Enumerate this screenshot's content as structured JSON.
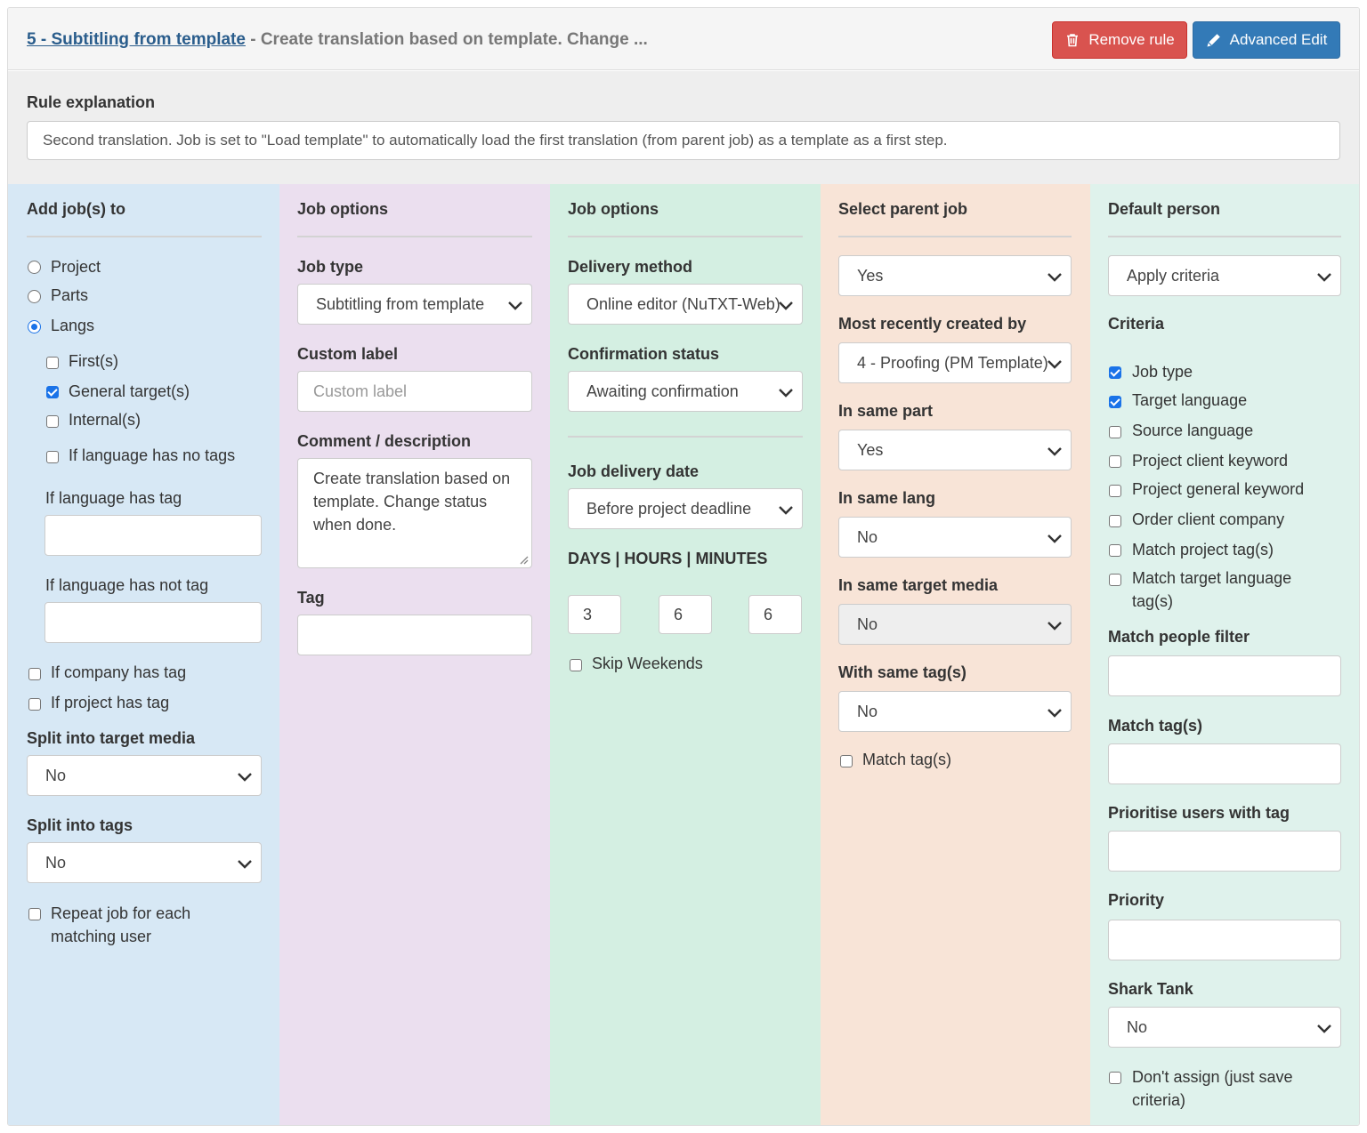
{
  "header": {
    "rule_link": "5 - Subtitling from template",
    "rule_subtitle": " - Create translation based on template. Change ...",
    "remove_label": "Remove rule",
    "advanced_label": "Advanced Edit"
  },
  "explanation": {
    "label": "Rule explanation",
    "value": "Second translation. Job is set to \"Load template\" to automatically load the first translation (from parent job) as a template as a first step."
  },
  "col1": {
    "title": "Add job(s) to",
    "radio_project": "Project",
    "radio_parts": "Parts",
    "radio_langs": "Langs",
    "selected_radio": "Langs",
    "cb_firsts": "First(s)",
    "cb_general": "General target(s)",
    "cb_internal": "Internal(s)",
    "cb_no_tags": "If language has no tags",
    "has_tag_label": "If language has tag",
    "has_tag_value": "",
    "has_not_tag_label": "If language has not tag",
    "has_not_tag_value": "",
    "cb_company_tag": "If company has tag",
    "cb_project_tag": "If project has tag",
    "split_media_label": "Split into target media",
    "split_media_value": "No",
    "split_tags_label": "Split into tags",
    "split_tags_value": "No",
    "cb_repeat": "Repeat job for each matching user"
  },
  "col2": {
    "title": "Job options",
    "job_type_label": "Job type",
    "job_type_value": "Subtitling from template",
    "custom_label_label": "Custom label",
    "custom_label_placeholder": "Custom label",
    "comment_label": "Comment / description",
    "comment_value": "Create translation based on template. Change status when done.",
    "tag_label": "Tag",
    "tag_value": ""
  },
  "col3": {
    "title": "Job options",
    "delivery_label": "Delivery method",
    "delivery_value": "Online editor (NuTXT-Web)",
    "confirmation_label": "Confirmation status",
    "confirmation_value": "Awaiting confirmation",
    "delivery_date_label": "Job delivery date",
    "delivery_date_value": "Before project deadline",
    "dhm_label": "DAYS | HOURS | MINUTES",
    "days": "3",
    "hours": "6",
    "minutes": "6",
    "cb_skip_weekends": "Skip Weekends"
  },
  "col4": {
    "title": "Select parent job",
    "parent_value": "Yes",
    "recent_label": "Most recently created by",
    "recent_value": "4 - Proofing (PM Template)",
    "same_part_label": "In same part",
    "same_part_value": "Yes",
    "same_lang_label": "In same lang",
    "same_lang_value": "No",
    "same_media_label": "In same target media",
    "same_media_value": "No",
    "same_tags_label": "With same tag(s)",
    "same_tags_value": "No",
    "cb_match_tags": "Match tag(s)"
  },
  "col5": {
    "title": "Default person",
    "apply_value": "Apply criteria",
    "criteria_label": "Criteria",
    "cb_job_type": "Job type",
    "cb_target_lang": "Target language",
    "cb_source_lang": "Source language",
    "cb_client_kw": "Project client keyword",
    "cb_general_kw": "Project general keyword",
    "cb_order_company": "Order client company",
    "cb_match_project_tags": "Match project tag(s)",
    "cb_match_target_tags": "Match target language tag(s)",
    "people_filter_label": "Match people filter",
    "people_filter_value": "",
    "match_tags_label": "Match tag(s)",
    "match_tags_value": "",
    "prioritise_label": "Prioritise users with tag",
    "prioritise_value": "",
    "priority_label": "Priority",
    "priority_value": "",
    "shark_label": "Shark Tank",
    "shark_value": "No",
    "cb_dont_assign": "Don't assign (just save criteria)"
  },
  "colors": {
    "danger": "#d9534f",
    "primary": "#337ab7",
    "link": "#2a5d8c",
    "col1_bg": "#d7e8f5",
    "col2_bg": "#ebdfef",
    "col3_bg": "#d4efe2",
    "col4_bg": "#f8e4d7",
    "col5_bg": "#dff2ec",
    "checkbox_accent": "#1a73e8"
  },
  "icons": {
    "remove": "trash-icon",
    "advanced": "pencil-icon",
    "select": "chevron-down-icon"
  }
}
